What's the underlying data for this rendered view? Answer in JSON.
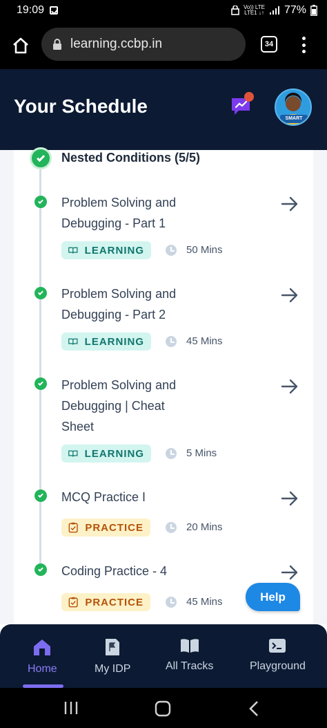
{
  "status_bar": {
    "time": "19:09",
    "network_line1": "Vo)) LTE",
    "network_line2": "LTE1 ↓↑",
    "battery": "77%"
  },
  "browser": {
    "url": "learning.ccbp.in",
    "tab_count": "34"
  },
  "header": {
    "title": "Your Schedule",
    "avatar_badge": "SMART"
  },
  "section": {
    "title": "Nested Conditions (5/5)"
  },
  "items": [
    {
      "title": "Problem Solving and Debugging - Part 1",
      "tag": "LEARNING",
      "duration": "50 Mins"
    },
    {
      "title": "Problem Solving and Debugging - Part 2",
      "tag": "LEARNING",
      "duration": "45 Mins"
    },
    {
      "title": "Problem Solving and Debugging | Cheat Sheet",
      "tag": "LEARNING",
      "duration": "5 Mins"
    },
    {
      "title": "MCQ Practice I",
      "tag": "PRACTICE",
      "duration": "20 Mins"
    },
    {
      "title": "Coding Practice - 4",
      "tag": "PRACTICE",
      "duration": "45 Mins"
    }
  ],
  "help_button": "Help",
  "bottom_nav": [
    {
      "label": "Home",
      "icon": "home-icon",
      "active": true
    },
    {
      "label": "My IDP",
      "icon": "document-flag-icon",
      "active": false
    },
    {
      "label": "All Tracks",
      "icon": "book-icon",
      "active": false
    },
    {
      "label": "Playground",
      "icon": "terminal-icon",
      "active": false
    }
  ],
  "colors": {
    "header_bg": "#0c1a33",
    "success_green": "#22b45a",
    "learning_tag_bg": "#d3f5ef",
    "learning_tag_text": "#0f766e",
    "practice_tag_bg": "#fdf1c7",
    "practice_tag_text": "#b45309",
    "active_nav": "#8b7cf6",
    "help_button": "#1e88e5"
  }
}
